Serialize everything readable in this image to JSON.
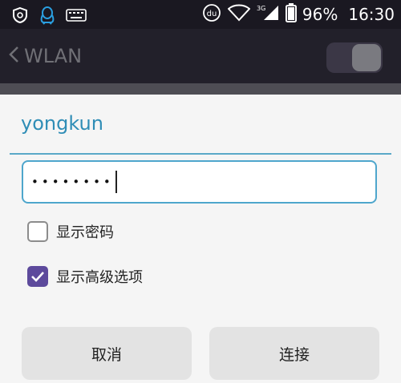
{
  "status_bar": {
    "battery_percent": "96%",
    "time": "16:30",
    "icons": [
      "shield-icon",
      "qq-penguin-icon",
      "keyboard-icon",
      "baidu-icon",
      "wifi-icon",
      "signal-icon",
      "battery-icon"
    ],
    "network_label": "3G"
  },
  "header": {
    "back_arrow": "<",
    "title": "WLAN",
    "wlan_enabled": true
  },
  "dialog": {
    "network_name": "yongkun",
    "password_masked": "••••••••",
    "options": [
      {
        "label": "显示密码",
        "checked": false
      },
      {
        "label": "显示高级选项",
        "checked": true
      }
    ],
    "buttons": {
      "cancel": "取消",
      "connect": "连接"
    }
  },
  "colors": {
    "accent": "#2f8db6",
    "checkbox_checked": "#5d4a9c"
  }
}
